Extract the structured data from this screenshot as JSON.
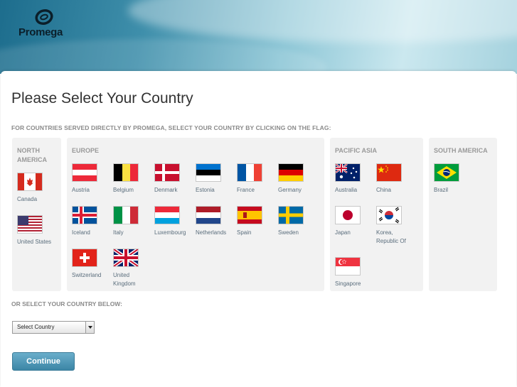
{
  "brand": {
    "name": "Promega"
  },
  "page": {
    "title": "Please Select Your Country",
    "instruction": "FOR COUNTRIES SERVED DIRECTLY BY PROMEGA, SELECT YOUR COUNTRY BY CLICKING ON THE FLAG:",
    "or_select": "OR SELECT YOUR COUNTRY BELOW:"
  },
  "regions": {
    "north_america": {
      "title": "NORTH AMERICA",
      "countries": [
        "Canada",
        "United States"
      ]
    },
    "europe": {
      "title": "EUROPE",
      "countries": [
        "Austria",
        "Belgium",
        "Denmark",
        "Estonia",
        "France",
        "Germany",
        "Iceland",
        "Italy",
        "Luxembourg",
        "Netherlands",
        "Spain",
        "Sweden",
        "Switzerland",
        "United Kingdom"
      ]
    },
    "pacific_asia": {
      "title": "PACIFIC ASIA",
      "countries": [
        "Australia",
        "China",
        "Japan",
        "Korea, Republic Of",
        "Singapore"
      ]
    },
    "south_america": {
      "title": "SOUTH AMERICA",
      "countries": [
        "Brazil"
      ]
    }
  },
  "select": {
    "value": "Select Country"
  },
  "continue_label": "Continue",
  "colors": {
    "accent": "#4a93b3",
    "region_bg": "#f2f2f2",
    "country_text": "#5a6d7c"
  }
}
